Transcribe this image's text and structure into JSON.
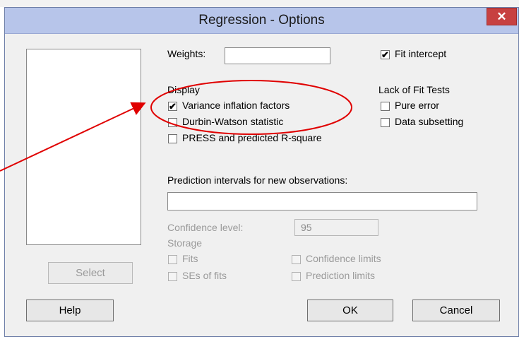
{
  "window": {
    "title": "Regression - Options",
    "close_label": "✕"
  },
  "weights": {
    "label": "Weights:",
    "value": ""
  },
  "fit_intercept": {
    "label": "Fit intercept",
    "checked": true
  },
  "display": {
    "heading": "Display",
    "vif": {
      "label": "Variance inflation factors",
      "checked": true
    },
    "durbin_watson": {
      "label": "Durbin-Watson statistic",
      "checked": false
    },
    "press": {
      "label": "PRESS and predicted R-square",
      "checked": false
    }
  },
  "lack_of_fit": {
    "heading": "Lack of Fit Tests",
    "pure_error": {
      "label": "Pure error",
      "checked": false
    },
    "data_subsetting": {
      "label": "Data subsetting",
      "checked": false
    }
  },
  "prediction": {
    "label": "Prediction intervals for new observations:",
    "value": ""
  },
  "confidence": {
    "label": "Confidence level:",
    "value": "95"
  },
  "storage": {
    "heading": "Storage",
    "fits": "Fits",
    "ses_of_fits": "SEs of fits",
    "confidence_limits": "Confidence limits",
    "prediction_limits": "Prediction limits"
  },
  "buttons": {
    "select": "Select",
    "help": "Help",
    "ok": "OK",
    "cancel": "Cancel"
  },
  "colors": {
    "titlebar": "#b7c5ea",
    "close": "#c74141",
    "annotation": "#e00000"
  },
  "check_glyph": "✔"
}
